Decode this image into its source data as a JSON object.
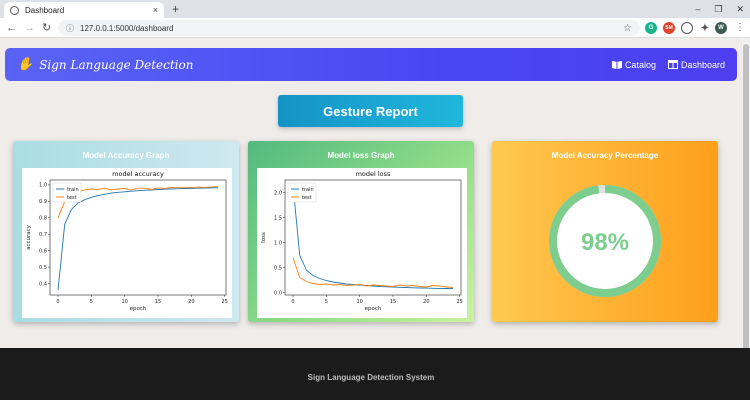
{
  "browser": {
    "tab_title": "Dashboard",
    "url": "127.0.0.1:5000/dashboard",
    "new_tab": "+",
    "close_tab": "×",
    "ext1": "G",
    "ext2": "SM",
    "ext3": "W"
  },
  "navbar": {
    "brand": "Sign Language Detection",
    "links": [
      {
        "label": "Catalog",
        "icon": "book-icon"
      },
      {
        "label": "Dashboard",
        "icon": "columns-icon"
      }
    ]
  },
  "report_button": "Gesture Report",
  "cards": {
    "accuracy": {
      "title": "Model Accuracy Graph"
    },
    "loss": {
      "title": "Model loss Graph"
    },
    "percentage": {
      "title": "Model Accuracy Percentage",
      "value": "98%",
      "fraction": 0.98,
      "ring_color": "#7ccd8e"
    }
  },
  "chart_data": [
    {
      "type": "line",
      "title": "model accuracy",
      "xlabel": "epoch",
      "ylabel": "accuracy",
      "xlim": [
        -1.2,
        25.2
      ],
      "ylim": [
        0.33,
        1.03
      ],
      "xticks": [
        0,
        5,
        10,
        15,
        20,
        25
      ],
      "yticks": [
        0.4,
        0.5,
        0.6,
        0.7,
        0.8,
        0.9,
        1.0
      ],
      "ytick_labels": [
        "0.4",
        "0.5",
        "0.6",
        "0.7",
        "0.8",
        "0.9",
        "1.0"
      ],
      "legend": "upper left",
      "x": [
        0,
        1,
        2,
        3,
        4,
        5,
        6,
        7,
        8,
        9,
        10,
        11,
        12,
        13,
        14,
        15,
        16,
        17,
        18,
        19,
        20,
        21,
        22,
        23,
        24
      ],
      "series": [
        {
          "name": "train",
          "color": "#1f77b4",
          "values": [
            0.36,
            0.76,
            0.85,
            0.89,
            0.91,
            0.925,
            0.935,
            0.943,
            0.95,
            0.955,
            0.958,
            0.962,
            0.965,
            0.967,
            0.97,
            0.972,
            0.974,
            0.975,
            0.977,
            0.978,
            0.979,
            0.98,
            0.981,
            0.982,
            0.983
          ]
        },
        {
          "name": "test",
          "color": "#ff7f0e",
          "values": [
            0.8,
            0.9,
            0.95,
            0.96,
            0.97,
            0.975,
            0.972,
            0.98,
            0.97,
            0.975,
            0.978,
            0.97,
            0.98,
            0.98,
            0.972,
            0.982,
            0.978,
            0.985,
            0.983,
            0.986,
            0.984,
            0.987,
            0.985,
            0.988,
            0.99
          ]
        }
      ]
    },
    {
      "type": "line",
      "title": "model loss",
      "xlabel": "epoch",
      "ylabel": "loss",
      "xlim": [
        -1.2,
        25.2
      ],
      "ylim": [
        -0.05,
        2.25
      ],
      "xticks": [
        0,
        5,
        10,
        15,
        20,
        25
      ],
      "yticks": [
        0.0,
        0.5,
        1.0,
        1.5,
        2.0
      ],
      "ytick_labels": [
        "0.0",
        "0.5",
        "1.0",
        "1.5",
        "2.0"
      ],
      "legend": "upper left",
      "x": [
        0,
        1,
        2,
        3,
        4,
        5,
        6,
        7,
        8,
        9,
        10,
        11,
        12,
        13,
        14,
        15,
        16,
        17,
        18,
        19,
        20,
        21,
        22,
        23,
        24
      ],
      "series": [
        {
          "name": "train",
          "color": "#1f77b4",
          "values": [
            2.15,
            0.75,
            0.45,
            0.34,
            0.28,
            0.24,
            0.21,
            0.19,
            0.17,
            0.16,
            0.15,
            0.14,
            0.13,
            0.12,
            0.115,
            0.11,
            0.105,
            0.1,
            0.095,
            0.09,
            0.088,
            0.085,
            0.082,
            0.08,
            0.078
          ]
        },
        {
          "name": "test",
          "color": "#ff7f0e",
          "values": [
            0.7,
            0.3,
            0.22,
            0.18,
            0.16,
            0.17,
            0.15,
            0.16,
            0.14,
            0.15,
            0.16,
            0.13,
            0.15,
            0.14,
            0.13,
            0.12,
            0.15,
            0.13,
            0.14,
            0.12,
            0.11,
            0.14,
            0.13,
            0.11,
            0.1
          ]
        }
      ]
    }
  ],
  "footer": "Sign Language Detection System"
}
